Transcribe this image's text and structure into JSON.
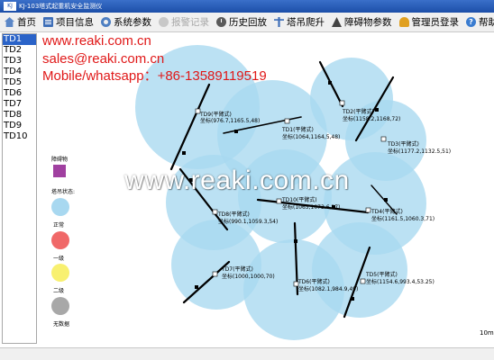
{
  "window": {
    "title": "KJ-103塔式起重机安全监测仪"
  },
  "menu": [
    {
      "label": "首页",
      "icon": "home-icon",
      "enabled": true
    },
    {
      "label": "项目信息",
      "icon": "project-info-icon",
      "enabled": true
    },
    {
      "label": "系统参数",
      "icon": "settings-icon",
      "enabled": true
    },
    {
      "label": "报警记录",
      "icon": "alarm-record-icon",
      "enabled": false
    },
    {
      "label": "历史回放",
      "icon": "history-icon",
      "enabled": true
    },
    {
      "label": "塔吊爬升",
      "icon": "crane-climb-icon",
      "enabled": true
    },
    {
      "label": "障碍物参数",
      "icon": "obstacle-icon",
      "enabled": true
    },
    {
      "label": "管理员登录",
      "icon": "admin-icon",
      "enabled": true
    },
    {
      "label": "帮助",
      "icon": "help-icon",
      "enabled": true
    }
  ],
  "crane_list": {
    "items": [
      "TD1",
      "TD2",
      "TD3",
      "TD4",
      "TD5",
      "TD6",
      "TD7",
      "TD8",
      "TD9",
      "TD10"
    ],
    "selected": "TD1"
  },
  "contact": {
    "website": "www.reaki.com.cn",
    "email": "sales@reaki.com.cn",
    "phone": "Mobile/whatsapp：+86-13589119519"
  },
  "legend": {
    "obstacle_label": "障碍物",
    "obstacle_color": "#a040a0",
    "status_label": "塔吊状态:",
    "states": [
      {
        "label": "正常",
        "color": "#a8d8f0"
      },
      {
        "label": "一级",
        "color": "#f06868"
      },
      {
        "label": "二级",
        "color": "#f8f070"
      },
      {
        "label": "无数据",
        "color": "#a8a8a8"
      }
    ]
  },
  "watermark": "www.reaki.com.cn",
  "scale": "10m",
  "cranes": [
    {
      "id": "TD9",
      "type": "(平臂式)",
      "coords": "坐标(976.7,1165.5,48)",
      "status": "normal"
    },
    {
      "id": "TD1",
      "type": "(平臂式)",
      "coords": "坐标(1064,1164,5,48)",
      "status": "normal"
    },
    {
      "id": "TD2",
      "type": "(平臂式)",
      "coords": "坐标(1158.2,1168,72)",
      "status": "normal"
    },
    {
      "id": "TD3",
      "type": "(平臂式)",
      "coords": "坐标(1177.2,1132.5,51)",
      "status": "normal"
    },
    {
      "id": "TD8",
      "type": "(平臂式)",
      "coords": "坐标(990.1,1059.3,54)",
      "status": "normal"
    },
    {
      "id": "TD10",
      "type": "(平臂式)",
      "coords": "坐标(1065,1073.6,27)",
      "status": "normal"
    },
    {
      "id": "TD4",
      "type": "(平臂式)",
      "coords": "坐标(1161.5,1060.3,71)",
      "status": "normal"
    },
    {
      "id": "TD7",
      "type": "(平臂式)",
      "coords": "坐标(1000,1000,70)",
      "status": "normal"
    },
    {
      "id": "TD6",
      "type": "(平臂式)",
      "coords": "坐标(1082.1,984.9,49)",
      "status": "normal"
    },
    {
      "id": "TD5",
      "type": "(平臂式)",
      "coords": "坐标(1154.6,993.4,53.25)",
      "status": "normal"
    }
  ],
  "colors": {
    "circle_fill": "#a8d8f0",
    "jib": "#000000",
    "menubar": "#f0f0f0",
    "selected": "#2a63c8",
    "red_text": "#e01818"
  }
}
